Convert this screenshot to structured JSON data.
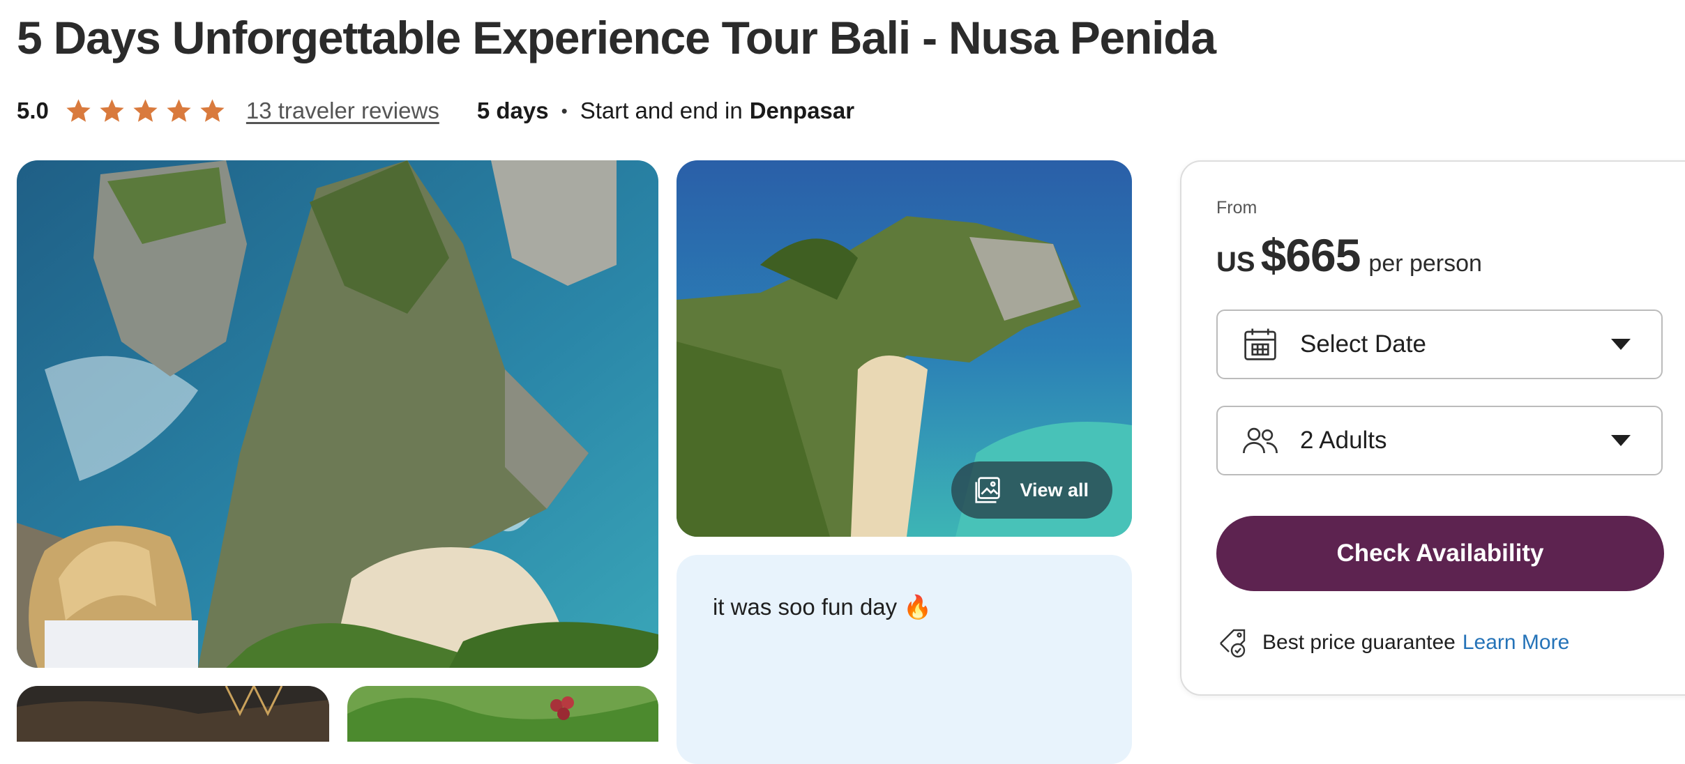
{
  "tour": {
    "title": "5 Days Unforgettable Experience Tour Bali - Nusa Penida",
    "rating": "5.0",
    "stars": 5,
    "reviews_link": "13 traveler reviews",
    "duration": "5 days",
    "start_end_prefix": "Start and end in",
    "city": "Denpasar"
  },
  "gallery": {
    "view_all_label": "View all",
    "review_snippet": "it was soo fun day 🔥"
  },
  "booking": {
    "from_label": "From",
    "currency": "US",
    "price": "$665",
    "price_suffix": "per person",
    "date_select": "Select Date",
    "travelers_select": "2 Adults",
    "check_button": "Check Availability",
    "guarantee_text": "Best price guarantee",
    "learn_more": "Learn More"
  },
  "colors": {
    "star": "#d97a3d",
    "primary_button": "#5d2350",
    "link": "#2573b8",
    "review_card_bg": "#e8f3fc"
  },
  "icons": [
    "star-icon",
    "image-gallery-icon",
    "calendar-icon",
    "users-icon",
    "chevron-down-icon",
    "price-tag-check-icon"
  ]
}
